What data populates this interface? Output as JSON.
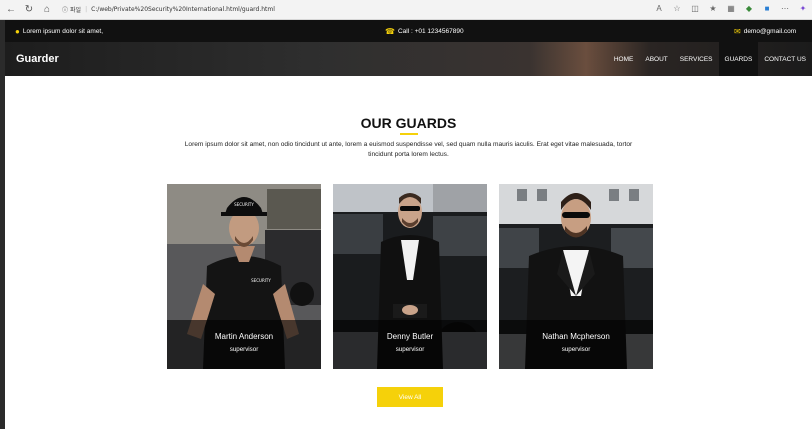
{
  "browser": {
    "info_label": "파일",
    "url": "C:/web/Private%20Security%20International.html/guard.html"
  },
  "topbar": {
    "address": "Lorem ipsum dolor sit amet,",
    "call": "Call : +01 1234567890",
    "email": "demo@gmail.com"
  },
  "header": {
    "logo": "Guarder",
    "menu": [
      {
        "label": "HOME"
      },
      {
        "label": "ABOUT"
      },
      {
        "label": "SERVICES"
      },
      {
        "label": "GUARDS"
      },
      {
        "label": "CONTACT US"
      }
    ],
    "active_menu": "GUARDS"
  },
  "section": {
    "title": "OUR GUARDS",
    "intro": "Lorem ipsum dolor sit amet, non odio tincidunt ut ante, lorem a euismod suspendisse vel, sed quam nulla mauris iaculis. Erat eget vitae malesuada, tortor tincidunt porta lorem lectus."
  },
  "guards": [
    {
      "name": "Martin Anderson",
      "role": "supervisor",
      "cap_text": "SECURITY",
      "shirt_text": "SECURITY"
    },
    {
      "name": "Denny Butler",
      "role": "supervisor"
    },
    {
      "name": "Nathan Mcpherson",
      "role": "supervisor"
    }
  ],
  "view_all": "View All",
  "colors": {
    "accent": "#f5d10a",
    "topbar_bg": "#111111",
    "page_bg": "#ffffff"
  }
}
